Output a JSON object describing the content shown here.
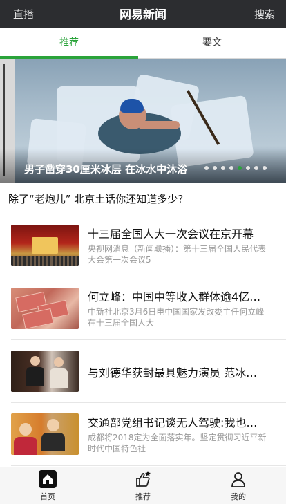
{
  "header": {
    "left_label": "直播",
    "title": "网易新闻",
    "right_label": "搜索"
  },
  "tabs": [
    {
      "label": "推荐",
      "active": true
    },
    {
      "label": "要文",
      "active": false
    }
  ],
  "hero": {
    "caption": "男子凿穿30厘米冰层 在冰水中沐浴",
    "slide_count": 8,
    "active_slide": 6
  },
  "headline": "除了“老炮儿” 北京土话你还知道多少?",
  "news": [
    {
      "title": "十三届全国人大一次会议在京开幕",
      "desc": "央视网消息（新闻联播）：第十三届全国人民代表大会第一次会议5"
    },
    {
      "title": "何立峰：中国中等收入群体逾4亿…",
      "desc": "中新社北京3月6日电中国国家发改委主任何立峰在十三届全国人大"
    },
    {
      "title": "与刘德华获封最具魅力演员 范冰…",
      "desc": ""
    },
    {
      "title": "交通部党组书记谈无人驾驶:我也…",
      "desc": "成都将2018定为全面落实年。坚定贯彻习近平新时代中国特色社"
    }
  ],
  "bottom_nav": [
    {
      "label": "首页",
      "icon": "home-icon"
    },
    {
      "label": "推荐",
      "icon": "thumbs-up-star-icon"
    },
    {
      "label": "我的",
      "icon": "person-icon"
    }
  ],
  "colors": {
    "header_bg": "#2c2d30",
    "accent_green": "#2aa33a",
    "muted_text": "#9a9a9a"
  }
}
